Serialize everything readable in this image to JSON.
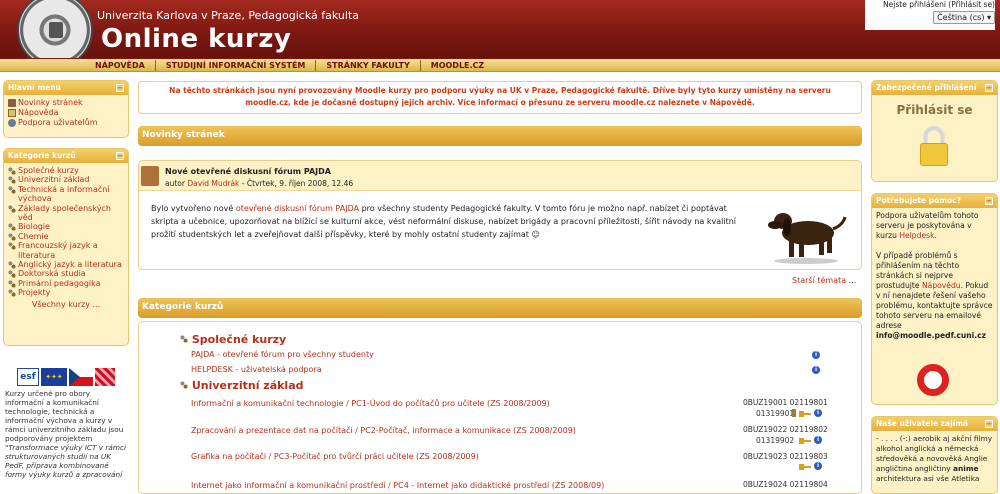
{
  "header": {
    "university": "Univerzita Karlova v Praze, Pedagogická fakulta",
    "site_title": "Online kurzy",
    "login_info": "Nejste přihlášeni (Přihlásit se)",
    "language": "Čeština (cs)"
  },
  "nav": [
    "NÁPOVĚDA",
    "STUDIJNÍ INFORMAČNÍ SYSTÉM",
    "STRÁNKY FAKULTY",
    "MOODLE.CZ"
  ],
  "left": {
    "main_menu": {
      "title": "Hlavní menu",
      "items": [
        "Novinky stránek",
        "Nápověda",
        "Podpora uživatelům"
      ]
    },
    "categories": {
      "title": "Kategorie kurzů",
      "items": [
        "Společné kurzy",
        "Univerzitní základ",
        "Technická a informační výchova",
        "Základy společenských věd",
        "Biologie",
        "Chemie",
        "Francouzský jazyk a literatura",
        "Anglický jazyk a literatura",
        "Doktorská studia",
        "Primární pedagogika",
        "Projekty"
      ],
      "all_link": "Všechny kurzy ..."
    },
    "esf_text": "Kurzy určené pro obory informační a komunikační technologie, technická a informační výchova a kurzy v rámci univerzitního základu jsou podporovány projektem",
    "esf_italic": "\"Transformace výuky ICT v rámci strukturovaných studií na UK PedF, příprava kombinované formy výuky kurzů a zpracování"
  },
  "notice": "Na těchto stránkách jsou nyní provozovány Moodle kurzy pro podporu výuky na UK v Praze, Pedagogické fakultě. Dříve byly tyto kurzy umístěny na serveru moodle.cz, kde je dočasně dostupný jejich archiv. Více informací o přesunu ze serveru moodle.cz naleznete v Nápovědě.",
  "news": {
    "section_title": "Novinky stránek",
    "post_title": "Nové otevřené diskusní fórum PAJDA",
    "author_prefix": "autor",
    "author": "David Mudrák",
    "date": " - Čtvrtek, 9. říjen 2008, 12.46",
    "body_1": "Bylo vytvořeno nové ",
    "body_link": "otevřené diskusní fórum PAJDA",
    "body_2": " pro všechny studenty Pedagogické fakulty. V tomto fóru je možno např. nabízet či poptávat skripta a učebnice, upozorňovat na blížící se kulturní akce, vést neformální diskuse, nabízet brigády a pracovní příležitosti, šířit návody na kvalitní prožití studentských let a zveřejňovat další příspěvky, které by mohly ostatní studenty zajímat",
    "older": "Starší témata",
    "older_dots": " ..."
  },
  "course_cats": {
    "section_title": "Kategorie kurzů",
    "groups": [
      {
        "name": "Společné kurzy",
        "courses": [
          {
            "title": "PAJDA - otevřené fórum pro všechny studenty",
            "ids": []
          },
          {
            "title": "HELPDESK - uživatelská podpora",
            "ids": []
          }
        ]
      },
      {
        "name": "Univerzitní základ",
        "courses": [
          {
            "title": "Informační a komunikační technologie / PC1-Úvod do počítačů pro učitele (ZS 2008/2009)",
            "ids": [
              "0BUZ19001 02119801",
              "01319901"
            ]
          },
          {
            "title": "Zpracování a prezentace dat na počítači / PC2-Počítač, informace a komunikace (ZS 2008/2009)",
            "ids": [
              "0BUZ19022 02119802",
              "01319902"
            ]
          },
          {
            "title": "Grafika na počítači / PC3-Počítač pro tvůrčí práci učitele (ZS 2008/2009)",
            "ids": [
              "0BUZ19023 02119803"
            ]
          },
          {
            "title": "Internet jako informační a komunikační prostředí / PC4 - Internet jako didaktické prostředí (ZS 2008/09)",
            "ids": [
              "0BUZ19024 02119804"
            ]
          }
        ]
      }
    ]
  },
  "right": {
    "secure": {
      "title": "Zabezpečené přihlášení",
      "login": "Přihlásit se"
    },
    "help": {
      "title": "Potřebujete pomoc?",
      "p1a": "Podpora uživatelům tohoto serveru je poskytována v kurzu ",
      "p1link": "Helpdesk",
      "p1b": ".",
      "p2a": "V případě problémů s přihlášením na těchto stránkách si nejprve prostudujte ",
      "p2link": "Nápovědu",
      "p2b": ". Pokud v ní nenajdete řešení vašeho problému, kontaktujte správce tohoto serveru na emailové adrese",
      "email": "info@moodle.pedf.cuni.cz"
    },
    "interests": {
      "title": "Naše uživatele zajímá",
      "text": "- . . . . (-:) aerobik aj akční filmy alkohol anglická a německá středověká a novověká Anglie angličtina angličtiny",
      "bold": "anime",
      "text2": " architektura asi vše Atletika"
    }
  },
  "colors": {
    "header": "#7a1710",
    "accent": "#e5b03a",
    "link": "#b5301a",
    "notice": "#d23a12"
  }
}
